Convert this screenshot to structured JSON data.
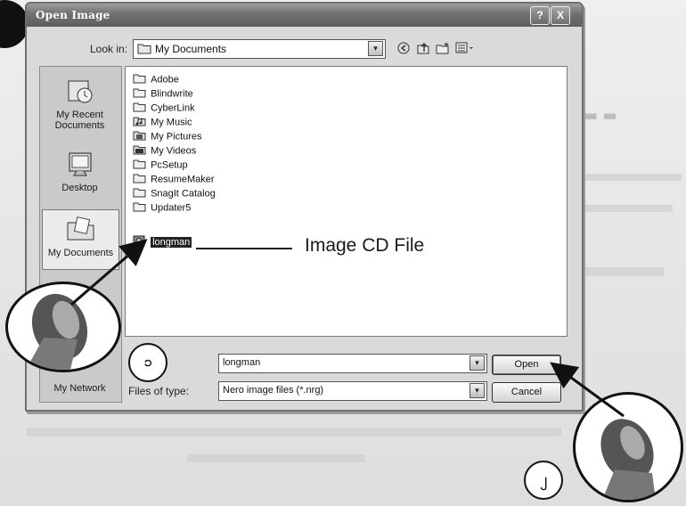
{
  "dialog": {
    "title": "Open Image",
    "help_symbol": "?",
    "close_symbol": "X",
    "look_in_label": "Look in:",
    "look_in_value": "My Documents",
    "dropdown_symbol": "▾"
  },
  "places": [
    {
      "label": "My Recent Documents",
      "icon": "recent-documents-icon"
    },
    {
      "label": "Desktop",
      "icon": "desktop-icon"
    },
    {
      "label": "My Documents",
      "icon": "my-documents-icon",
      "selected": true
    },
    {
      "label": "My Network",
      "icon": "network-icon"
    }
  ],
  "files": [
    {
      "name": "Adobe",
      "icon": "folder-icon"
    },
    {
      "name": "Blindwrite",
      "icon": "folder-icon"
    },
    {
      "name": "CyberLink",
      "icon": "folder-icon"
    },
    {
      "name": "My Music",
      "icon": "music-folder-icon"
    },
    {
      "name": "My Pictures",
      "icon": "pictures-folder-icon"
    },
    {
      "name": "My Videos",
      "icon": "videos-folder-icon"
    },
    {
      "name": "PcSetup",
      "icon": "folder-icon"
    },
    {
      "name": "ResumeMaker",
      "icon": "folder-icon"
    },
    {
      "name": "SnagIt Catalog",
      "icon": "folder-icon"
    },
    {
      "name": "Updater5",
      "icon": "folder-icon"
    },
    {
      "name": "longman",
      "icon": "image-file-icon",
      "selected": true
    }
  ],
  "callout": {
    "label": "Image CD File"
  },
  "file_name": {
    "value": "longman"
  },
  "files_of_type": {
    "label": "Files of type:",
    "value": "Nero image files (*.nrg)"
  },
  "buttons": {
    "open": "Open",
    "cancel": "Cancel"
  },
  "step_numbers": {
    "first": "၁",
    "second": "၂"
  }
}
